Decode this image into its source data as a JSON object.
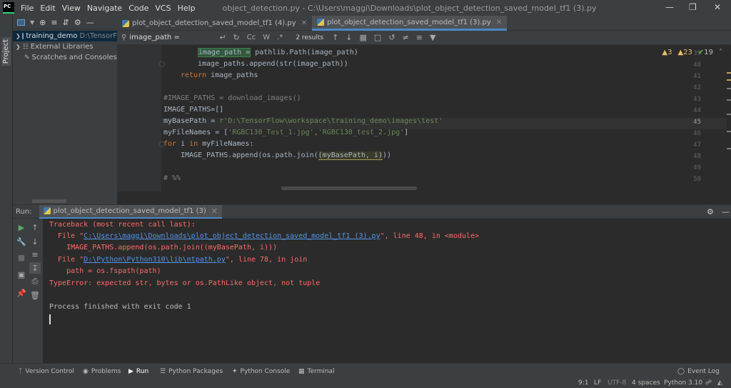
{
  "menu": [
    "File",
    "Edit",
    "View",
    "Navigate",
    "Code",
    "VCS",
    "Help"
  ],
  "window_title": "object_detection.py - C:\\Users\\maggi\\Downloads\\plot_object_detection_saved_model_tf1 (3).py",
  "sidebar_label": "Project",
  "project": {
    "root": "training_demo",
    "root_path": "D:\\TensorF",
    "external": "External Libraries",
    "scratches": "Scratches and Consoles"
  },
  "tabs": [
    {
      "label": "plot_object_detection_saved_model_tf1 (4).py",
      "active": false
    },
    {
      "label": "plot_object_detection_saved_model_tf1 (3).py",
      "active": true
    }
  ],
  "find": {
    "query": "image_path =",
    "case": "Cc",
    "word": "W",
    "regex": ".*",
    "results": "2 results"
  },
  "inspections": {
    "warnings": "3",
    "weak_warnings": "23",
    "ok": "19"
  },
  "code": {
    "line_numbers": [
      "39",
      "40",
      "41",
      "42",
      "43",
      "44",
      "45",
      "46",
      "47",
      "48",
      "49",
      "50"
    ],
    "current_line": "45",
    "l39a": "image_path =",
    "l39b": " pathlib.Path(image_path)",
    "l40": "image_paths.append(str(image_path))",
    "l41k": "return",
    "l41b": " image_paths",
    "l43": "#IMAGE_PATHS = download_images()",
    "l44": "IMAGE_PATHS=[]",
    "l45a": "myBasePath = ",
    "l45b": "r'D:\\TensorFlow\\workspace\\training_demo\\images\\test'",
    "l46a": "myFileNames = [",
    "l46b": "'RGBC130_Test_1.jpg'",
    "l46c": ",",
    "l46d": "'RGBC130_test_2.jpg'",
    "l46e": "]",
    "l47k1": "for",
    "l47a": " i ",
    "l47k2": "in",
    "l47b": " myFileNames:",
    "l48a": "IMAGE_PATHS.append(os.path.join(",
    "l48b": "(myBasePath, i)",
    "l48c": "))",
    "l50": "# %%"
  },
  "run": {
    "label": "Run:",
    "config": "plot_object_detection_saved_model_tf1 (3)"
  },
  "console": {
    "l1": "Traceback (most recent call last):",
    "l2a": "  File \"",
    "l2b": "C:\\Users\\maggi\\Downloads\\plot_object_detection_saved_model_tf1 (3).py",
    "l2c": "\", line 48, in <module>",
    "l3": "    IMAGE_PATHS.append(os.path.join((myBasePath, i)))",
    "l4a": "  File \"",
    "l4b": "D:\\Python\\Python310\\lib\\ntpath.py",
    "l4c": "\", line 78, in join",
    "l5": "    path = os.fspath(path)",
    "l6": "TypeError: expected str, bytes or os.PathLike object, not tuple",
    "l7": "Process finished with exit code 1"
  },
  "bottom_tabs": [
    "Version Control",
    "Problems",
    "Run",
    "Python Packages",
    "Python Console",
    "Terminal"
  ],
  "event_log": "Event Log",
  "status": {
    "position": "9:1",
    "line_sep": "LF",
    "encoding": "UTF-8",
    "indent": "4 spaces",
    "interpreter": "Python 3.10"
  }
}
